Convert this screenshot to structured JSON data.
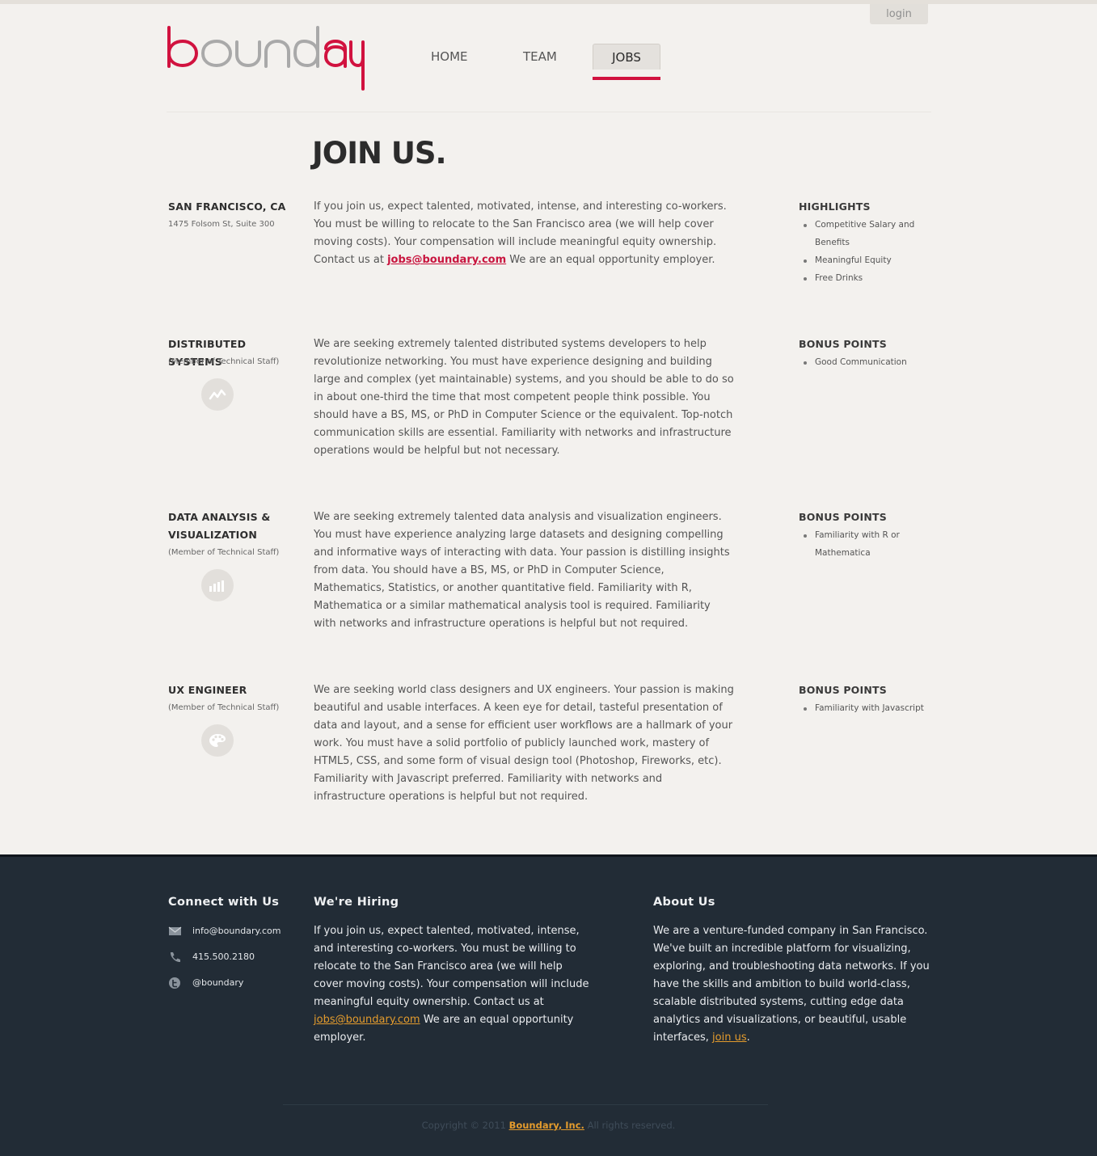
{
  "header": {
    "login_label": "login",
    "logo_alt": "boundary",
    "nav": {
      "home": "HOME",
      "team": "TEAM",
      "jobs": "JOBS"
    }
  },
  "main": {
    "title": "JOIN US.",
    "intro": {
      "location": "SAN FRANCISCO, CA",
      "address": "1475 Folsom St, Suite 300",
      "text_before": "If you join us, expect talented, motivated, intense, and interesting co-workers. You must be willing to relocate to the San Francisco area (we will help cover moving costs). Your compensation will include meaningful equity ownership. Contact us at ",
      "email": "jobs@boundary.com",
      "text_after": " We are an equal opportunity employer.",
      "highlights_title": "HIGHLIGHTS",
      "highlights": [
        "Competitive Salary and Benefits",
        "Meaningful Equity",
        "Free Drinks"
      ]
    },
    "jobs": [
      {
        "title": "DISTRIBUTED SYSTEMS",
        "subtitle": "(Member of Technical Staff)",
        "icon": "line-chart-icon",
        "description": "We are seeking extremely talented distributed systems developers to help revolutionize networking. You must have experience designing and building large and complex (yet maintainable) systems, and you should be able to do so in about one-third the time that most competent people think possible. You should have a BS, MS, or PhD in Computer Science or the equivalent. Top-notch communication skills are essential. Familiarity with networks and infrastructure operations would be helpful but not necessary.",
        "bonus_title": "BONUS POINTS",
        "bonus": [
          "Good Communication"
        ]
      },
      {
        "title": "DATA ANALYSIS & VISUALIZATION",
        "subtitle": "(Member of Technical Staff)",
        "icon": "bar-chart-icon",
        "description": "We are seeking extremely talented data analysis and visualization engineers. You must have experience analyzing large datasets and designing compelling and informative ways of interacting with data. Your passion is distilling insights from data. You should have a BS, MS, or PhD in Computer Science, Mathematics, Statistics, or another quantitative field. Familiarity with R, Mathematica or a similar mathematical analysis tool is required. Familiarity with networks and infrastructure operations is helpful but not required.",
        "bonus_title": "BONUS POINTS",
        "bonus": [
          "Familiarity with R or Mathematica"
        ]
      },
      {
        "title": "UX ENGINEER",
        "subtitle": "(Member of Technical Staff)",
        "icon": "palette-icon",
        "description": "We are seeking world class designers and UX engineers. Your passion is making beautiful and usable interfaces. A keen eye for detail, tasteful presentation of data and layout, and a sense for efficient user workflows are a hallmark of your work. You must have a solid portfolio of publicly launched work, mastery of HTML5, CSS, and some form of visual design tool (Photoshop, Fireworks, etc). Familiarity with Javascript preferred. Familiarity with networks and infrastructure operations is helpful but not required.",
        "bonus_title": "BONUS POINTS",
        "bonus": [
          "Familiarity with Javascript"
        ]
      }
    ]
  },
  "footer": {
    "connect": {
      "title": "Connect with Us",
      "email": "info@boundary.com",
      "phone": "415.500.2180",
      "twitter": "@boundary"
    },
    "hiring": {
      "title": "We're Hiring",
      "text_before": "If you join us, expect talented, motivated, intense, and interesting co-workers. You must be willing to relocate to the San Francisco area (we will help cover moving costs). Your compensation will include meaningful equity ownership. Contact us at ",
      "email": "jobs@boundary.com",
      "text_after": " We are an equal opportunity employer."
    },
    "about": {
      "title": "About Us",
      "text_before": "We are a venture-funded company in San Francisco. We've built an incredible platform for visualizing, exploring, and troubleshooting data networks. If you have the skills and ambition to build world-class, scalable distributed systems, cutting edge data analytics and visualizations, or beautiful, usable interfaces, ",
      "link": "join us",
      "text_after": "."
    },
    "copyright": {
      "prefix": "Copyright © 2011 ",
      "company": "Boundary, Inc.",
      "suffix": " All rights reserved."
    }
  },
  "colors": {
    "accent": "#d1123f",
    "footer_bg": "#222c36",
    "footer_link": "#e39b2d",
    "page_bg": "#f3f1ee"
  }
}
